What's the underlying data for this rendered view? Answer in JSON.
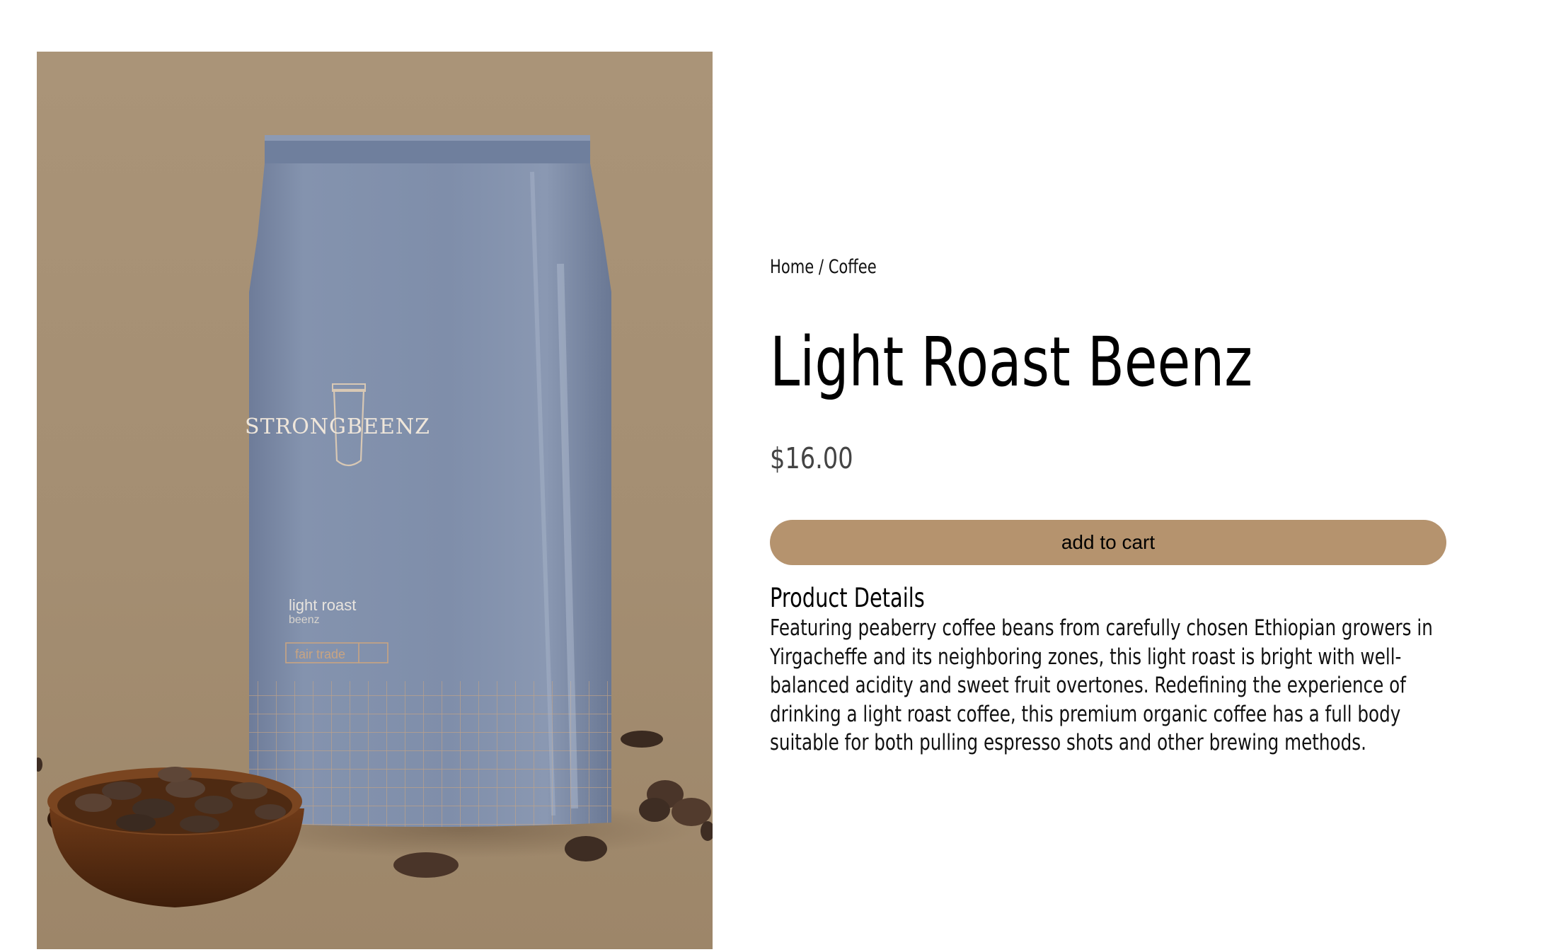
{
  "product_image": {
    "alt": "Light Roast Beenz coffee bag",
    "bag_brand": "STRONGBEENZ",
    "bag_line1": "light roast",
    "bag_line2": "beenz",
    "bag_tag": "fair trade"
  },
  "breadcrumb": {
    "home": "Home",
    "separator": "/",
    "current": "Coffee"
  },
  "product": {
    "title": "Light Roast Beenz",
    "price": "$16.00"
  },
  "cart": {
    "add_label": "add to cart"
  },
  "details": {
    "heading": "Product Details",
    "description": "Featuring peaberry coffee beans from carefully chosen Ethiopian growers in Yirgacheffe and its neighboring zones, this light roast is bright with well-balanced acidity and sweet fruit overtones. Redefining the experience of drinking a light roast coffee, this premium organic coffee has a full body suitable for both pulling espresso shots and other brewing methods."
  },
  "colors": {
    "accent_button": "#b5936e",
    "image_background": "#a89274",
    "bag_blue": "#7c8aa6",
    "price_text": "#444444"
  }
}
